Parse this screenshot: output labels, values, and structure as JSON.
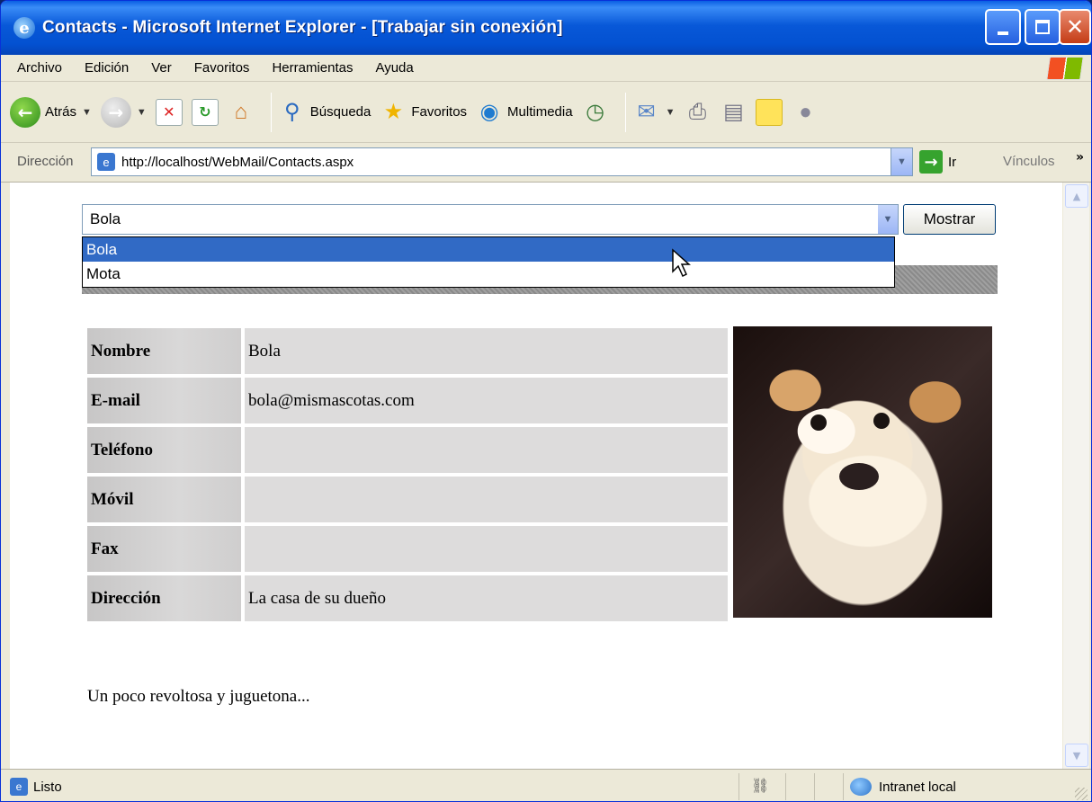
{
  "window": {
    "title": "Contacts - Microsoft Internet Explorer - [Trabajar sin conexión]"
  },
  "menu": [
    "Archivo",
    "Edición",
    "Ver",
    "Favoritos",
    "Herramientas",
    "Ayuda"
  ],
  "toolbar": {
    "back": "Atrás",
    "search": "Búsqueda",
    "favorites": "Favoritos",
    "media": "Multimedia"
  },
  "address": {
    "label": "Dirección",
    "url": "http://localhost/WebMail/Contacts.aspx",
    "go": "Ir",
    "links": "Vínculos"
  },
  "page": {
    "select_value": "Bola",
    "button": "Mostrar",
    "options": [
      "Bola",
      "Mota"
    ],
    "selected_option": "Bola",
    "rows": [
      {
        "label": "Nombre",
        "value": "Bola"
      },
      {
        "label": "E-mail",
        "value": "bola@mismascotas.com"
      },
      {
        "label": "Teléfono",
        "value": ""
      },
      {
        "label": "Móvil",
        "value": ""
      },
      {
        "label": "Fax",
        "value": ""
      },
      {
        "label": "Dirección",
        "value": "La casa de su dueño"
      }
    ],
    "description": "Un poco revoltosa y juguetona..."
  },
  "status": {
    "text": "Listo",
    "zone": "Intranet local"
  }
}
